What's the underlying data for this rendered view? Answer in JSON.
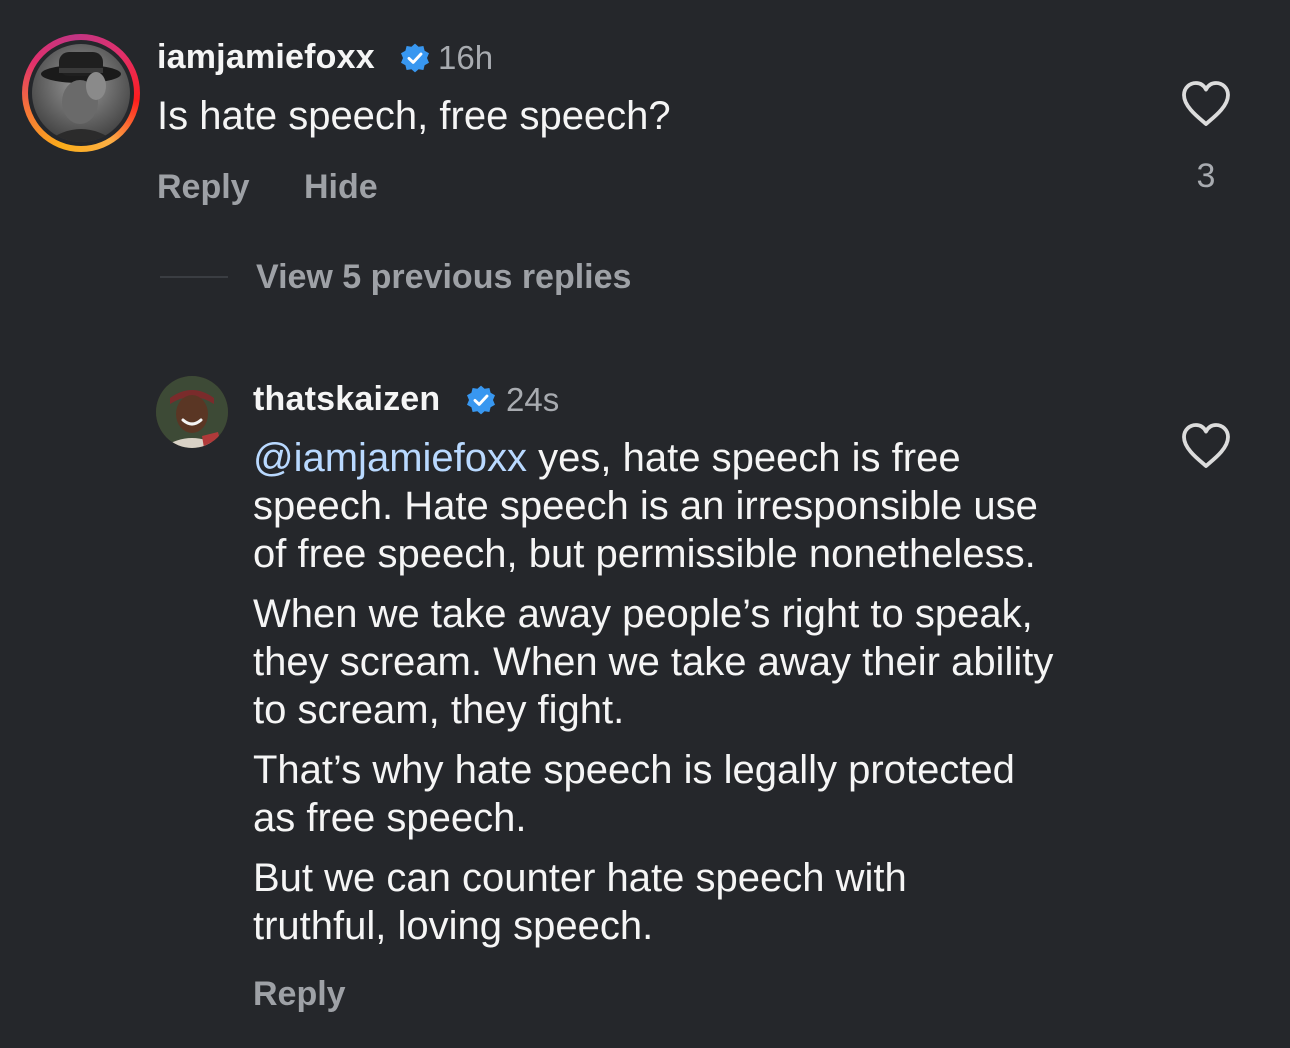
{
  "main_comment": {
    "username": "iamjamiefoxx",
    "time": "16h",
    "text": "Is hate speech, free speech?",
    "reply_label": "Reply",
    "hide_label": "Hide",
    "like_count": "3"
  },
  "view_replies_label": "View 5 previous replies",
  "reply_comment": {
    "username": "thatskaizen",
    "time": "24s",
    "mention": "@iamjamiefoxx",
    "paragraphs": [
      " yes, hate speech is free\nspeech. Hate speech is an irresponsible use\nof free speech, but permissible nonetheless.",
      "When we take away people’s right to speak,\nthey scream. When we take away their ability\nto scream, they fight.",
      "That’s why hate speech is legally protected\nas free speech.",
      "But we can counter hate speech with\ntruthful, loving speech."
    ],
    "reply_label": "Reply"
  },
  "colors": {
    "background": "#25272b",
    "verified": "#3897f0",
    "mention": "#b9d9ff",
    "muted": "#9ea1a6"
  }
}
